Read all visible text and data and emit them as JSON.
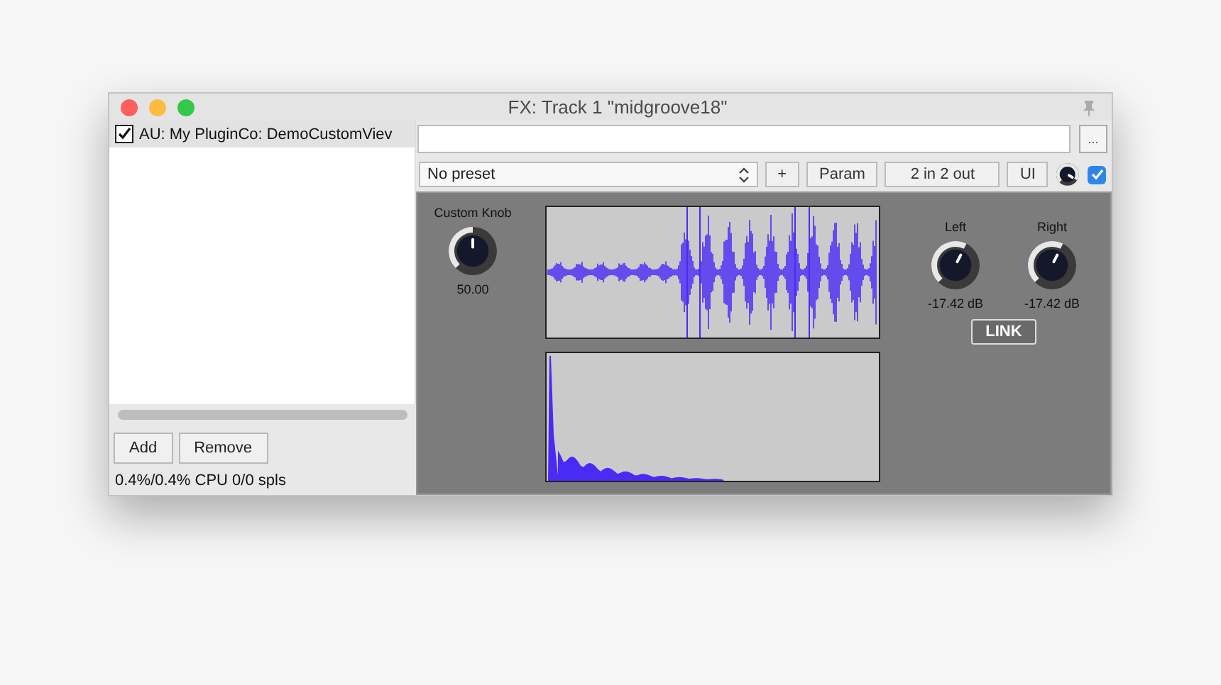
{
  "window": {
    "title": "FX: Track 1 \"midgroove18\""
  },
  "fx_list": {
    "items": [
      {
        "label": "AU: My PluginCo: DemoCustomViev",
        "checked": true,
        "selected": true
      }
    ]
  },
  "buttons": [
    {
      "label": "Add"
    },
    {
      "label": "Remove"
    }
  ],
  "status": "0.4%/0.4% CPU 0/0 spls",
  "browse_button": "...",
  "preset": {
    "value": "No preset"
  },
  "toolbar": [
    {
      "label": "+"
    },
    {
      "label": "Param"
    },
    {
      "label": "2 in 2 out"
    },
    {
      "label": "UI"
    }
  ],
  "wet_knob": {
    "level": 0.95
  },
  "enabled": {
    "checked": true
  },
  "plugin": {
    "custom_knob": {
      "label": "Custom Knob",
      "reading": "50.00",
      "level": 0.5
    },
    "meters": [
      {
        "label": "Left",
        "reading": "-17.42 dB",
        "level": 0.6
      },
      {
        "label": "Right",
        "reading": "-17.42 dB",
        "level": 0.6
      }
    ],
    "link_button": "LINK"
  }
}
